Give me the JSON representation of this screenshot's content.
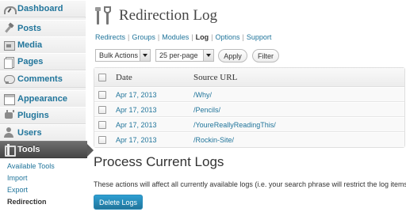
{
  "sidebar": {
    "items": [
      {
        "label": "Dashboard",
        "icon": "dashboard-icon"
      },
      {
        "label": "Posts",
        "icon": "pushpin-icon"
      },
      {
        "label": "Media",
        "icon": "media-icon"
      },
      {
        "label": "Pages",
        "icon": "pages-icon"
      },
      {
        "label": "Comments",
        "icon": "comments-icon"
      },
      {
        "label": "Appearance",
        "icon": "appearance-icon"
      },
      {
        "label": "Plugins",
        "icon": "plugins-icon"
      },
      {
        "label": "Users",
        "icon": "users-icon"
      },
      {
        "label": "Tools",
        "icon": "tools-icon",
        "active": true
      }
    ],
    "submenu": [
      {
        "label": "Available Tools"
      },
      {
        "label": "Import"
      },
      {
        "label": "Export"
      },
      {
        "label": "Redirection",
        "current": true
      }
    ]
  },
  "page": {
    "title": "Redirection Log",
    "icon": "tools-icon"
  },
  "subnav": {
    "items": [
      "Redirects",
      "Groups",
      "Modules",
      "Log",
      "Options",
      "Support"
    ],
    "current": "Log",
    "separator": "|"
  },
  "toolbar": {
    "bulk_actions": "Bulk Actions",
    "per_page": "25 per-page",
    "apply_label": "Apply",
    "filter_label": "Filter"
  },
  "table": {
    "columns": [
      "Date",
      "Source URL"
    ],
    "rows": [
      {
        "date": "Apr 17, 2013",
        "source": "/Why/"
      },
      {
        "date": "Apr 17, 2013",
        "source": "/Pencils/"
      },
      {
        "date": "Apr 17, 2013",
        "source": "/YoureReallyReadingThis/"
      },
      {
        "date": "Apr 17, 2013",
        "source": "/Rockin-Site/"
      }
    ]
  },
  "process": {
    "title": "Process Current Logs",
    "note": "These actions will affect all currently available logs (i.e. your search phrase will restrict the log items).",
    "delete_label": "Delete Logs"
  },
  "colors": {
    "link": "#21759b",
    "active_menu": "#464646",
    "primary_button": "#21759b"
  }
}
